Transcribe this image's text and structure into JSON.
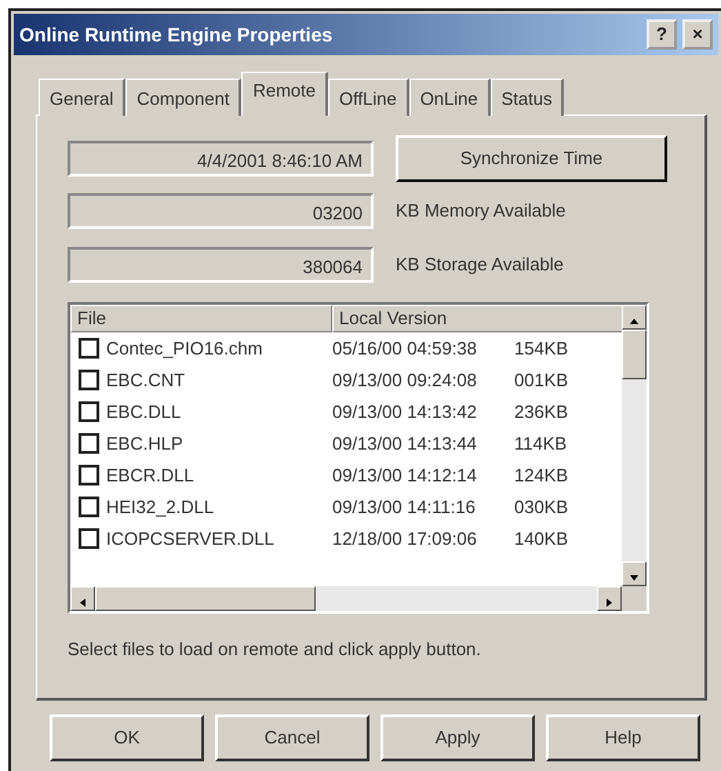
{
  "window": {
    "title": "Online Runtime Engine Properties",
    "title_buttons": [
      "?",
      "×"
    ]
  },
  "tabs": [
    {
      "label": "General",
      "selected": false
    },
    {
      "label": "Component",
      "selected": false
    },
    {
      "label": "Remote",
      "selected": true
    },
    {
      "label": "OffLine",
      "selected": false
    },
    {
      "label": "OnLine",
      "selected": false
    },
    {
      "label": "Status",
      "selected": false
    }
  ],
  "time": {
    "value": "4/4/2001 8:46:10 AM",
    "button": "Synchronize Time"
  },
  "memory": {
    "value": "03200",
    "label": "KB Memory Available"
  },
  "storage": {
    "value": "380064",
    "label": "KB Storage Available"
  },
  "file_list": {
    "columns": [
      "File",
      "Local Version"
    ],
    "rows": [
      {
        "file": "Contec_PIO16.chm",
        "local_version": "05/16/00 04:59:38",
        "column_3": "154KB",
        "checked": false
      },
      {
        "file": "EBC.CNT",
        "local_version": "09/13/00 09:24:08",
        "column_3": "001KB",
        "checked": false
      },
      {
        "file": "EBC.DLL",
        "local_version": "09/13/00 14:13:42",
        "column_3": "236KB",
        "checked": false
      },
      {
        "file": "EBC.HLP",
        "local_version": "09/13/00 14:13:44",
        "column_3": "114KB",
        "checked": false
      },
      {
        "file": "EBCR.DLL",
        "local_version": "09/13/00 14:12:14",
        "column_3": "124KB",
        "checked": false
      },
      {
        "file": "HEI32_2.DLL",
        "local_version": "09/13/00 14:11:16",
        "column_3": "030KB",
        "checked": false
      },
      {
        "file": "ICOPCSERVER.DLL",
        "local_version": "12/18/00 17:09:06",
        "column_3": "140KB",
        "checked": false
      }
    ]
  },
  "hint": "Select files to load on remote and click apply button.",
  "buttons": [
    "OK",
    "Cancel",
    "Apply",
    "Help"
  ]
}
